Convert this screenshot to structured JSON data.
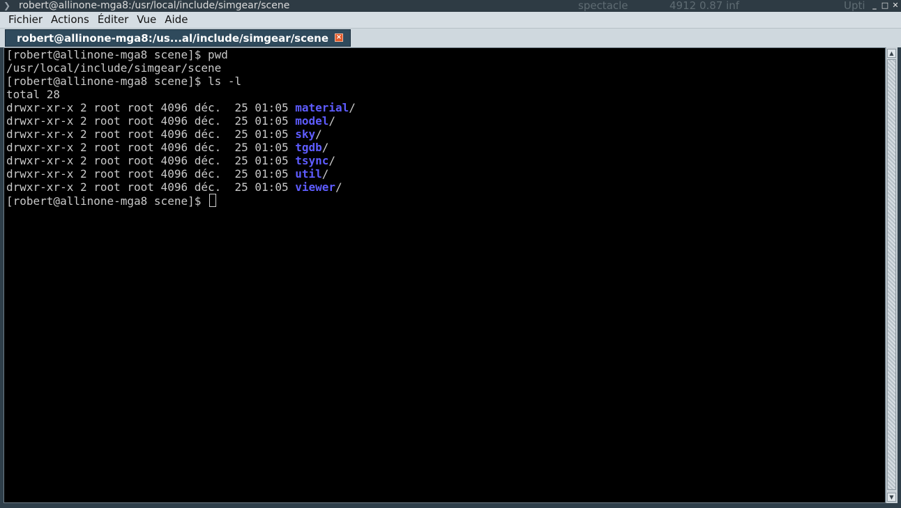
{
  "window": {
    "title": "robert@allinone-mga8:/usr/local/include/simgear/scene",
    "panel_left": "spectacle",
    "panel_mid": "4912  0.87  inf",
    "panel_right": "Upti",
    "buttons": {
      "minimize": "_",
      "maximize": "□",
      "close": "✕"
    }
  },
  "menubar": {
    "items": [
      "Fichier",
      "Actions",
      "Éditer",
      "Vue",
      "Aide"
    ]
  },
  "tabs": [
    {
      "label": "robert@allinone-mga8:/us...al/include/simgear/scene",
      "close": "×"
    }
  ],
  "terminal": {
    "lines": [
      {
        "text": "[robert@allinone-mga8 scene]$ pwd"
      },
      {
        "text": "/usr/local/include/simgear/scene"
      },
      {
        "text": "[robert@allinone-mga8 scene]$ ls -l"
      },
      {
        "text": "total 28"
      },
      {
        "prefix": "drwxr-xr-x 2 root root 4096 déc.  25 01:05 ",
        "dir": "material",
        "suffix": "/"
      },
      {
        "prefix": "drwxr-xr-x 2 root root 4096 déc.  25 01:05 ",
        "dir": "model",
        "suffix": "/"
      },
      {
        "prefix": "drwxr-xr-x 2 root root 4096 déc.  25 01:05 ",
        "dir": "sky",
        "suffix": "/"
      },
      {
        "prefix": "drwxr-xr-x 2 root root 4096 déc.  25 01:05 ",
        "dir": "tgdb",
        "suffix": "/"
      },
      {
        "prefix": "drwxr-xr-x 2 root root 4096 déc.  25 01:05 ",
        "dir": "tsync",
        "suffix": "/"
      },
      {
        "prefix": "drwxr-xr-x 2 root root 4096 déc.  25 01:05 ",
        "dir": "util",
        "suffix": "/"
      },
      {
        "prefix": "drwxr-xr-x 2 root root 4096 déc.  25 01:05 ",
        "dir": "viewer",
        "suffix": "/"
      },
      {
        "text": "[robert@allinone-mga8 scene]$ "
      }
    ]
  },
  "colors": {
    "directory": "#5e5cff",
    "terminal_bg": "#000000",
    "terminal_fg": "#c9c9c9",
    "tab_bg": "#2f4a5c",
    "tab_close": "#e05a2a"
  },
  "icons": {
    "app": "terminal-icon",
    "scroll_up": "chevron-up-icon",
    "scroll_down": "chevron-down-icon",
    "tab_close": "close-icon"
  }
}
